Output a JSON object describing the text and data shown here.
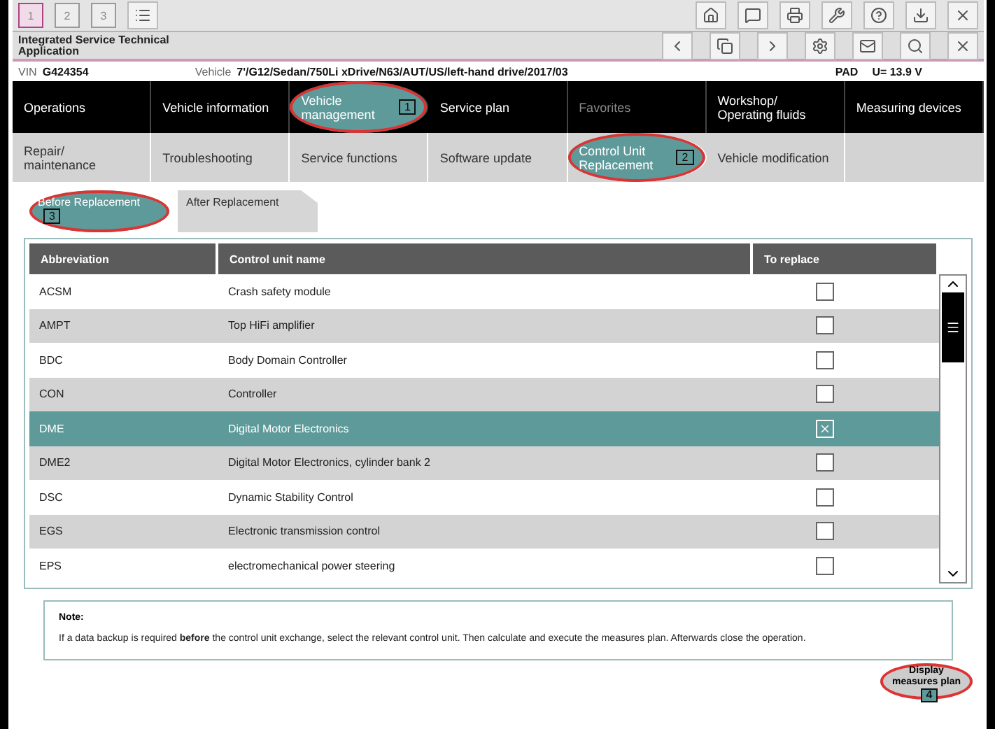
{
  "window_tabs": [
    {
      "label": "1",
      "selected": true
    },
    {
      "label": "2",
      "selected": false
    },
    {
      "label": "3",
      "selected": false
    }
  ],
  "app_title": "Integrated Service Technical Application",
  "vehicle_bar": {
    "vin_label": "VIN",
    "vin": "G424354",
    "vehicle_label": "Vehicle",
    "vehicle": "7'/G12/Sedan/750Li xDrive/N63/AUT/US/left-hand drive/2017/03",
    "pad": "PAD",
    "voltage": "U= 13.9 V"
  },
  "main_nav": [
    {
      "label": "Operations",
      "selected": false,
      "disabled": false
    },
    {
      "label": "Vehicle information",
      "selected": false,
      "disabled": false
    },
    {
      "label": "Vehicle management",
      "selected": true,
      "disabled": false,
      "annotation": "1"
    },
    {
      "label": "Service plan",
      "selected": false,
      "disabled": false
    },
    {
      "label": "Favorites",
      "selected": false,
      "disabled": true
    },
    {
      "label": "Workshop/ Operating fluids",
      "selected": false,
      "disabled": false
    },
    {
      "label": "Measuring devices",
      "selected": false,
      "disabled": false
    }
  ],
  "sub_nav": [
    {
      "label": "Repair/ maintenance",
      "selected": false
    },
    {
      "label": "Troubleshooting",
      "selected": false
    },
    {
      "label": "Service functions",
      "selected": false
    },
    {
      "label": "Software update",
      "selected": false
    },
    {
      "label": "Control Unit Replacement",
      "selected": true,
      "annotation": "2"
    },
    {
      "label": "Vehicle modification",
      "selected": false
    }
  ],
  "tabs": [
    {
      "label": "Before Replacement",
      "selected": true,
      "annotation": "3"
    },
    {
      "label": "After Replacement",
      "selected": false
    }
  ],
  "table": {
    "columns": [
      "Abbreviation",
      "Control unit name",
      "To replace"
    ],
    "rows": [
      {
        "abbreviation": "ACSM",
        "name": "Crash safety module",
        "checked": false,
        "selected": false
      },
      {
        "abbreviation": "AMPT",
        "name": "Top HiFi amplifier",
        "checked": false,
        "selected": false
      },
      {
        "abbreviation": "BDC",
        "name": "Body Domain Controller",
        "checked": false,
        "selected": false
      },
      {
        "abbreviation": "CON",
        "name": "Controller",
        "checked": false,
        "selected": false
      },
      {
        "abbreviation": "DME",
        "name": "Digital Motor Electronics",
        "checked": true,
        "selected": true
      },
      {
        "abbreviation": "DME2",
        "name": "Digital Motor Electronics, cylinder bank 2",
        "checked": false,
        "selected": false
      },
      {
        "abbreviation": "DSC",
        "name": "Dynamic Stability Control",
        "checked": false,
        "selected": false
      },
      {
        "abbreviation": "EGS",
        "name": "Electronic transmission control",
        "checked": false,
        "selected": false
      },
      {
        "abbreviation": "EPS",
        "name": "electromechanical power steering",
        "checked": false,
        "selected": false
      }
    ]
  },
  "note": {
    "title": "Note:",
    "text": "If a data backup is required **before** the control unit exchange, select the relevant control unit. Then calculate and execute the measures plan. Afterwards close the operation."
  },
  "action_button": {
    "label": "Display measures plan",
    "annotation": "4"
  }
}
